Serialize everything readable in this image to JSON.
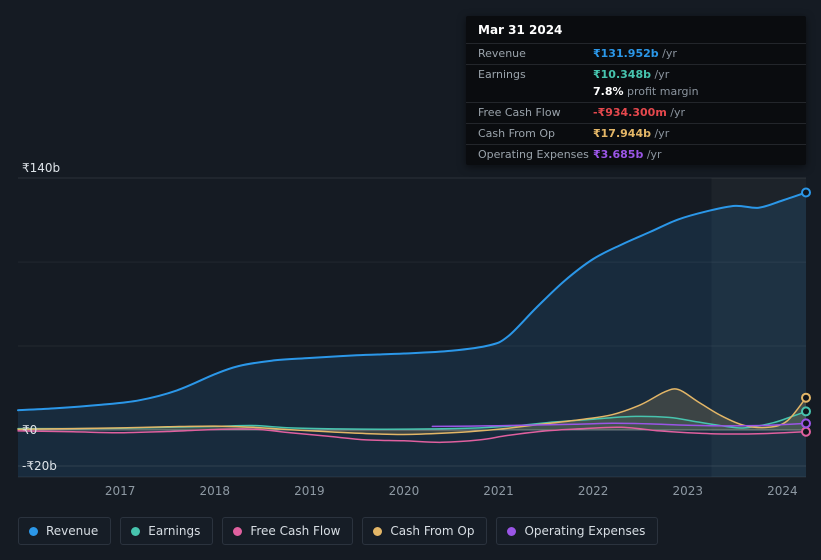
{
  "tooltip": {
    "date": "Mar 31 2024",
    "rows": [
      {
        "label": "Revenue",
        "value": "₹131.952b",
        "suffix": " /yr",
        "color": "#2b97e8"
      },
      {
        "label": "Earnings",
        "value": "₹10.348b",
        "suffix": " /yr",
        "color": "#47c4ae"
      },
      {
        "label": "",
        "value": "7.8%",
        "suffix": " profit margin",
        "color": "#ffffff"
      },
      {
        "label": "Free Cash Flow",
        "value": "-₹934.300m",
        "suffix": " /yr",
        "color": "#e5484d"
      },
      {
        "label": "Cash From Op",
        "value": "₹17.944b",
        "suffix": " /yr",
        "color": "#e3b667"
      },
      {
        "label": "Operating Expenses",
        "value": "₹3.685b",
        "suffix": " /yr",
        "color": "#9a55e6"
      }
    ]
  },
  "legend": {
    "items": [
      {
        "key": "revenue",
        "label": "Revenue",
        "color": "#2b97e8"
      },
      {
        "key": "earnings",
        "label": "Earnings",
        "color": "#47c4ae"
      },
      {
        "key": "free-cash-flow",
        "label": "Free Cash Flow",
        "color": "#e0609f"
      },
      {
        "key": "cash-from-op",
        "label": "Cash From Op",
        "color": "#e3b667"
      },
      {
        "key": "operating-expenses",
        "label": "Operating Expenses",
        "color": "#9a55e6"
      }
    ]
  },
  "chart_data": {
    "type": "line",
    "title": "",
    "xlabel": "",
    "ylabel": "",
    "xlim": [
      2015.92,
      2024.25
    ],
    "ylim": [
      -26.1,
      140
    ],
    "highlight_from": 2023.25,
    "x_ticks": [
      2017,
      2018,
      2019,
      2020,
      2021,
      2022,
      2023,
      2024
    ],
    "y_ticks": [
      {
        "value": 140,
        "label": "₹140b",
        "above": true
      },
      {
        "value": 0,
        "label": "₹0"
      },
      {
        "value": -20,
        "label": "-₹20b"
      }
    ],
    "y_gridlines_minor": [
      93.3,
      46.7
    ],
    "series": [
      {
        "name": "Revenue",
        "color": "#2b97e8",
        "fill": "rgba(43,140,220,0.14)",
        "fill_to": "bottom",
        "width": 2,
        "points": [
          [
            2015.92,
            11
          ],
          [
            2016.3,
            12
          ],
          [
            2016.8,
            14
          ],
          [
            2017.2,
            16.5
          ],
          [
            2017.6,
            22
          ],
          [
            2018.0,
            31
          ],
          [
            2018.25,
            35.5
          ],
          [
            2018.6,
            38.5
          ],
          [
            2019.0,
            40
          ],
          [
            2019.5,
            41.5
          ],
          [
            2020.0,
            42.5
          ],
          [
            2020.5,
            44
          ],
          [
            2020.9,
            47
          ],
          [
            2021.1,
            52
          ],
          [
            2021.4,
            68
          ],
          [
            2021.7,
            83
          ],
          [
            2022.0,
            95
          ],
          [
            2022.3,
            103
          ],
          [
            2022.6,
            110
          ],
          [
            2022.9,
            117
          ],
          [
            2023.2,
            121.5
          ],
          [
            2023.5,
            124.5
          ],
          [
            2023.75,
            123.5
          ],
          [
            2024.0,
            127.5
          ],
          [
            2024.25,
            131.952
          ]
        ]
      },
      {
        "name": "Earnings",
        "color": "#47c4ae",
        "fill": "rgba(71,196,174,0.12)",
        "fill_to": "zero",
        "width": 1.5,
        "points": [
          [
            2015.92,
            0.8
          ],
          [
            2016.5,
            0.8
          ],
          [
            2017.0,
            1.0
          ],
          [
            2017.5,
            1.5
          ],
          [
            2018.0,
            2.0
          ],
          [
            2018.4,
            2.5
          ],
          [
            2018.8,
            1.2
          ],
          [
            2019.3,
            0.6
          ],
          [
            2019.8,
            0.4
          ],
          [
            2020.3,
            0.6
          ],
          [
            2020.8,
            1.2
          ],
          [
            2021.2,
            2.5
          ],
          [
            2021.6,
            4.5
          ],
          [
            2022.0,
            6.0
          ],
          [
            2022.4,
            7.5
          ],
          [
            2022.8,
            7.0
          ],
          [
            2023.1,
            4.5
          ],
          [
            2023.4,
            2.0
          ],
          [
            2023.6,
            1.2
          ],
          [
            2023.9,
            4.0
          ],
          [
            2024.1,
            7.5
          ],
          [
            2024.25,
            10.348
          ]
        ]
      },
      {
        "name": "Free Cash Flow",
        "color": "#e0609f",
        "width": 1.5,
        "points": [
          [
            2015.92,
            -0.5
          ],
          [
            2016.5,
            -1.0
          ],
          [
            2017.0,
            -1.5
          ],
          [
            2017.5,
            -0.8
          ],
          [
            2018.0,
            0.3
          ],
          [
            2018.4,
            0.5
          ],
          [
            2018.8,
            -1.5
          ],
          [
            2019.2,
            -3.5
          ],
          [
            2019.6,
            -5.5
          ],
          [
            2020.0,
            -6.0
          ],
          [
            2020.4,
            -6.8
          ],
          [
            2020.8,
            -5.5
          ],
          [
            2021.1,
            -3.0
          ],
          [
            2021.5,
            -0.5
          ],
          [
            2021.9,
            0.8
          ],
          [
            2022.3,
            1.5
          ],
          [
            2022.7,
            -0.5
          ],
          [
            2023.0,
            -1.5
          ],
          [
            2023.4,
            -2.2
          ],
          [
            2023.8,
            -2.0
          ],
          [
            2024.1,
            -1.3
          ],
          [
            2024.25,
            -0.934
          ]
        ]
      },
      {
        "name": "Cash From Op",
        "color": "#e3b667",
        "fill": "rgba(227,182,103,0.18)",
        "fill_to": "zero",
        "width": 1.5,
        "points": [
          [
            2015.92,
            0.4
          ],
          [
            2016.5,
            0.8
          ],
          [
            2017.0,
            1.2
          ],
          [
            2017.5,
            1.8
          ],
          [
            2018.0,
            2.2
          ],
          [
            2018.4,
            1.5
          ],
          [
            2018.8,
            0.2
          ],
          [
            2019.2,
            -1.0
          ],
          [
            2019.6,
            -2.0
          ],
          [
            2020.0,
            -2.5
          ],
          [
            2020.4,
            -1.8
          ],
          [
            2020.8,
            -0.5
          ],
          [
            2021.1,
            1.0
          ],
          [
            2021.5,
            3.5
          ],
          [
            2021.9,
            6.0
          ],
          [
            2022.2,
            8.5
          ],
          [
            2022.5,
            14.0
          ],
          [
            2022.75,
            21.0
          ],
          [
            2022.9,
            22.5
          ],
          [
            2023.1,
            16.0
          ],
          [
            2023.35,
            8.0
          ],
          [
            2023.6,
            2.5
          ],
          [
            2023.85,
            1.5
          ],
          [
            2024.05,
            5.0
          ],
          [
            2024.25,
            17.944
          ]
        ]
      },
      {
        "name": "Operating Expenses",
        "color": "#9a55e6",
        "width": 1.5,
        "points": [
          [
            2020.3,
            2.0
          ],
          [
            2020.7,
            2.2
          ],
          [
            2021.0,
            2.4
          ],
          [
            2021.4,
            2.8
          ],
          [
            2021.8,
            3.2
          ],
          [
            2022.2,
            3.8
          ],
          [
            2022.6,
            3.4
          ],
          [
            2023.0,
            2.6
          ],
          [
            2023.4,
            2.3
          ],
          [
            2023.8,
            2.5
          ],
          [
            2024.0,
            3.0
          ],
          [
            2024.25,
            3.685
          ]
        ]
      }
    ]
  }
}
